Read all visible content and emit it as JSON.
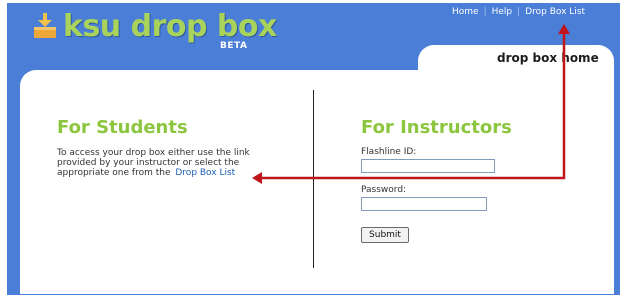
{
  "app": {
    "logo_text": "ksu drop box",
    "badge": "BETA",
    "logo_icon": "dropbox-tray-icon"
  },
  "nav": {
    "items": [
      {
        "label": "Home"
      },
      {
        "label": "Help"
      },
      {
        "label": "Drop Box List"
      }
    ]
  },
  "tab": {
    "label": "drop box home"
  },
  "students": {
    "heading": "For Students",
    "text_line1": "To access your drop box either use the link",
    "text_line2": "provided by your instructor or select the",
    "text_line3": "appropriate one from the",
    "link": "Drop Box List"
  },
  "instructors": {
    "heading": "For Instructors",
    "flashline_label": "Flashline ID:",
    "flashline_value": "",
    "password_label": "Password:",
    "password_value": "",
    "submit_label": "Submit"
  },
  "colors": {
    "header_bg": "#4b7ed7",
    "heading_green": "#8cc63f",
    "annotation_arrow": "#c0161b"
  }
}
